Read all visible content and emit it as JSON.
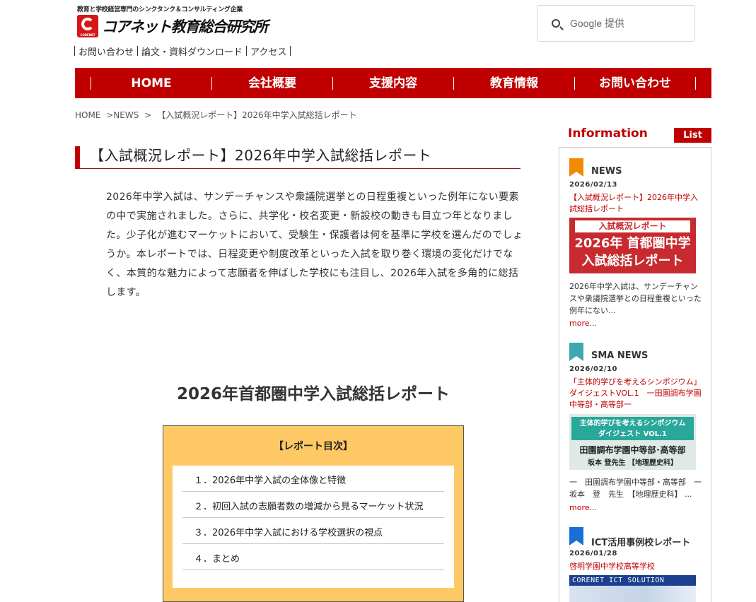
{
  "header": {
    "tagline": "教育と学校経営専門のシンクタンク＆コンサルティング企業",
    "logo_sub": "CORENET",
    "logo_name": "コアネット教育総合研究所",
    "search_placeholder": "Google 提供",
    "util_links": [
      "お問い合わせ",
      "論文・資料ダウンロード",
      "アクセス"
    ]
  },
  "nav": {
    "items": [
      "HOME",
      "会社概要",
      "支援内容",
      "教育情報",
      "お問い合わせ"
    ],
    "color": "#c00000"
  },
  "breadcrumb": [
    "HOME",
    ">NEWS",
    ">",
    "【入試概況レポート】2026年中学入試総括レポート"
  ],
  "article": {
    "title": "【入試概況レポート】2026年中学入試総括レポート",
    "lead": "2026年中学入試は、サンデーチャンスや衆議院選挙との日程重複といった例年にない要素の中で実施されました。さらに、共学化・校名変更・新設校の動きも目立つ年となりました。少子化が進むマーケットにおいて、受験生・保護者は何を基準に学校を選んだのでしょうか。本レポートでは、日程変更や制度改革といった入試を取り巻く環境の変化だけでなく、本質的な魅力によって志願者を伸ばした学校にも注目し、2026年入試を多角的に総括します。",
    "report_heading": "2026年首都圏中学入試総括レポート",
    "toc_title": "【レポート目次】",
    "toc_items": [
      "１．2026年中学入試の全体像と特徴",
      "２．初回入試の志願者数の増減から見るマーケット状況",
      "３．2026年中学入試における学校選択の視点",
      "４．まとめ"
    ],
    "toc_bg": "#fec964"
  },
  "sidebar": {
    "title": "Information",
    "list_label": "List",
    "sections": [
      {
        "label": "NEWS",
        "flag_color": "#f08a00",
        "date": "2026/02/13",
        "link": "【入試概況レポート】2026年中学入試総括レポート",
        "thumb_top": "入試概況レポート",
        "thumb_main": [
          "2026年 首都圏中学",
          "入試総括レポート"
        ],
        "desc": "2026年中学入試は、サンデーチャンスや衆議院選挙との日程重複といった例年にない...",
        "more": "more..."
      },
      {
        "label": "SMA NEWS",
        "flag_color": "#3fa7b3",
        "date": "2026/02/10",
        "link": "「主体的学びを考えるシンポジウム」ダイジェストVOL.1　一田園調布学園中等部・高等部一",
        "thumb_band": [
          "主体的学びを考えるシンポジウム",
          "ダイジェスト VOL.1"
        ],
        "thumb_school": "田園調布学園中等部･高等部",
        "thumb_person": "坂本 登先生 【地理歴史科】",
        "desc": "一　田園調布学園中等部・高等部　一　坂本　登　先生　【地理歴史科】 ...",
        "more": "more..."
      },
      {
        "label": "ICT活用事例校レポート",
        "flag_color": "#1a6fd6",
        "date": "2026/01/28",
        "link": "啓明学園中学校高等学校",
        "thumb_head": "CORENET ICT SOLUTION"
      }
    ]
  }
}
